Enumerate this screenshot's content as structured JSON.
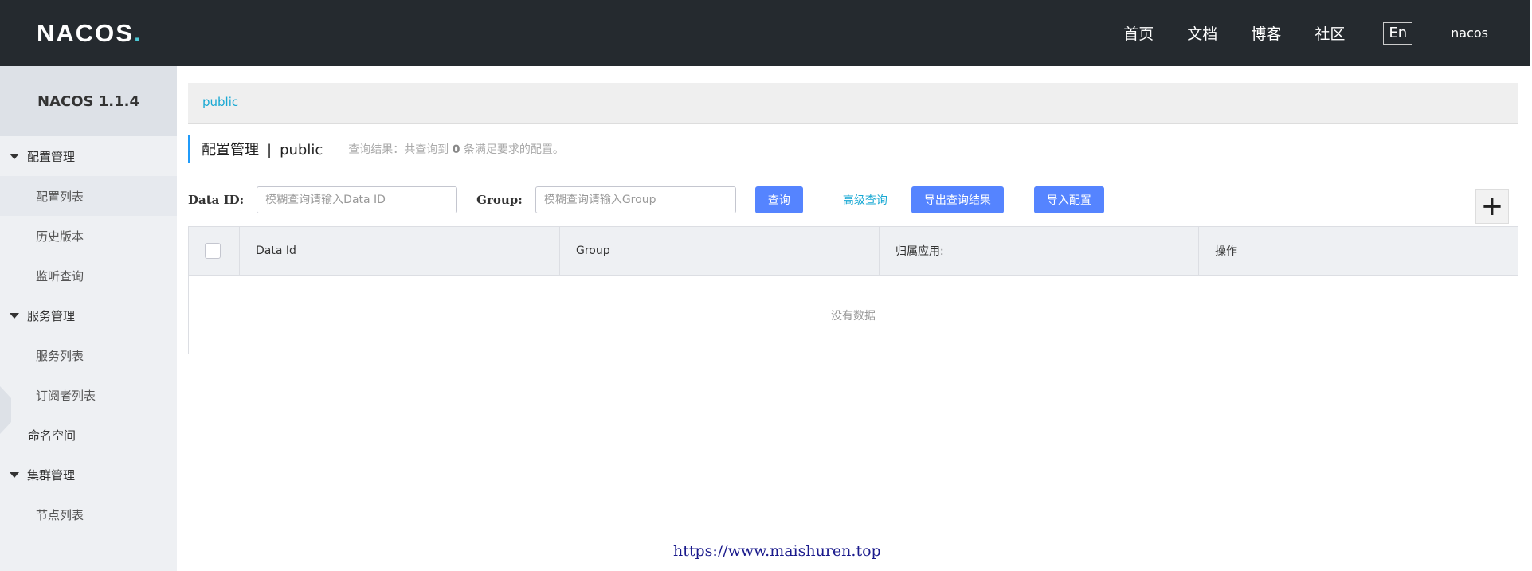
{
  "header": {
    "logo": "NACOS",
    "logo_dot": ".",
    "nav": [
      "首页",
      "文档",
      "博客",
      "社区"
    ],
    "lang": "En",
    "user": "nacos"
  },
  "sidebar": {
    "version": "NACOS 1.1.4",
    "groups": [
      {
        "label": "配置管理",
        "items": [
          "配置列表",
          "历史版本",
          "监听查询"
        ]
      },
      {
        "label": "服务管理",
        "items": [
          "服务列表",
          "订阅者列表"
        ]
      }
    ],
    "namespace": "命名空间",
    "cluster": {
      "label": "集群管理",
      "items": [
        "节点列表"
      ]
    }
  },
  "main": {
    "namespace_tab": "public",
    "title": "配置管理",
    "title_sep": "|",
    "title_ns": "public",
    "result_prefix": "查询结果：共查询到",
    "result_count": "0",
    "result_suffix": "条满足要求的配置。",
    "filters": {
      "dataid_label": "Data ID:",
      "dataid_placeholder": "模糊查询请输入Data ID",
      "group_label": "Group:",
      "group_placeholder": "模糊查询请输入Group",
      "query": "查询",
      "advanced": "高级查询",
      "export": "导出查询结果",
      "import": "导入配置"
    },
    "add_symbol": "+",
    "table": {
      "columns": [
        "Data Id",
        "Group",
        "归属应用:",
        "操作"
      ],
      "empty": "没有数据"
    }
  },
  "watermark": "https://www.maishuren.top"
}
